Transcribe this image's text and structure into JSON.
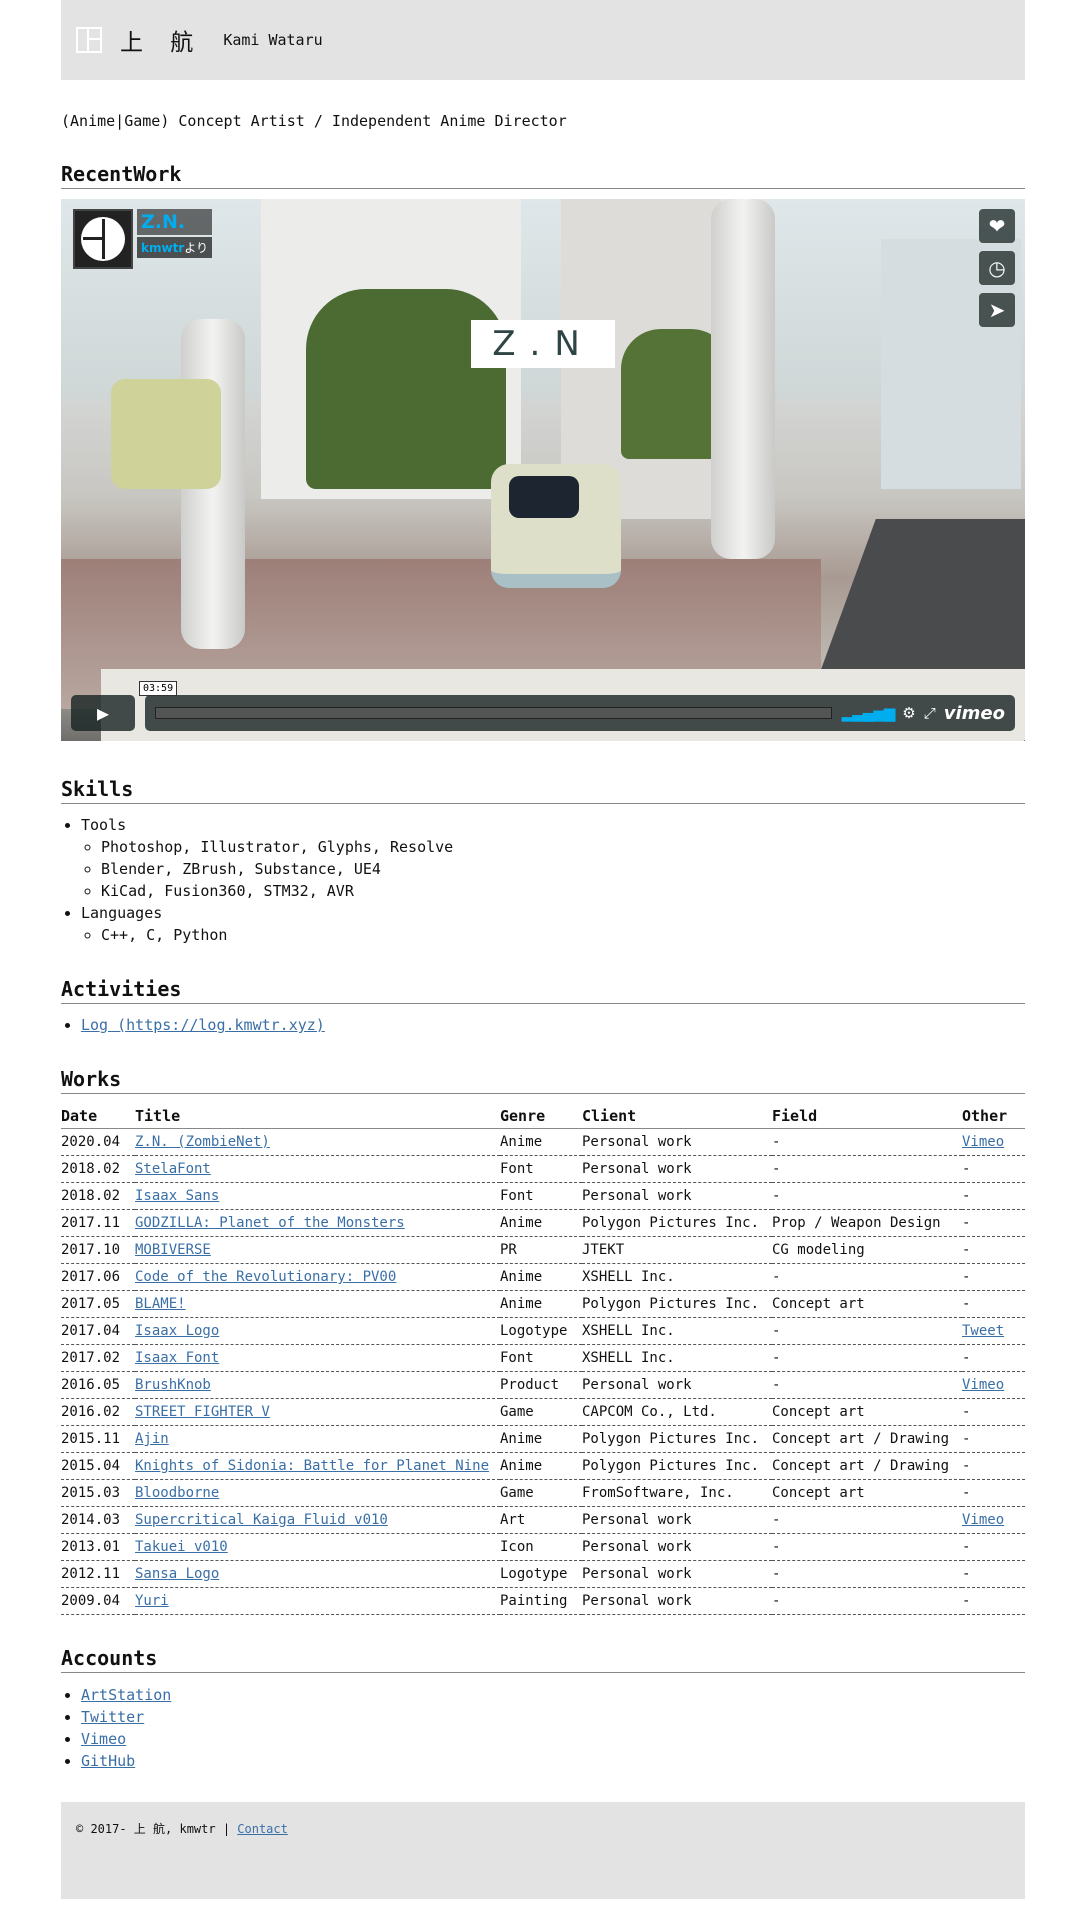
{
  "header": {
    "site_name": "上 航",
    "site_roman": "Kami Wataru"
  },
  "tagline": "(Anime|Game) Concept Artist / Independent Anime Director",
  "recent_work": {
    "heading": "RecentWork",
    "video": {
      "title": "Z.N.",
      "by_user": "kmwtr",
      "by_suffix": "より",
      "sign_text": "Z.N",
      "duration": "03:59",
      "brand": "vimeo"
    }
  },
  "skills": {
    "heading": "Skills",
    "groups": [
      {
        "label": "Tools",
        "items": [
          "Photoshop, Illustrator, Glyphs, Resolve",
          "Blender, ZBrush, Substance, UE4",
          "KiCad, Fusion360, STM32, AVR"
        ]
      },
      {
        "label": "Languages",
        "items": [
          "C++, C, Python"
        ]
      }
    ]
  },
  "activities": {
    "heading": "Activities",
    "items": [
      "Log (https://log.kmwtr.xyz)"
    ]
  },
  "works": {
    "heading": "Works",
    "columns": [
      "Date",
      "Title",
      "Genre",
      "Client",
      "Field",
      "Other"
    ],
    "rows": [
      [
        "2020.04",
        "Z.N. (ZombieNet)",
        "Anime",
        "Personal work",
        "-",
        "Vimeo"
      ],
      [
        "2018.02",
        "StelaFont",
        "Font",
        "Personal work",
        "-",
        "-"
      ],
      [
        "2018.02",
        "Isaax Sans",
        "Font",
        "Personal work",
        "-",
        "-"
      ],
      [
        "2017.11",
        "GODZILLA: Planet of the Monsters",
        "Anime",
        "Polygon Pictures Inc.",
        "Prop / Weapon Design",
        "-"
      ],
      [
        "2017.10",
        "MOBIVERSE",
        "PR",
        "JTEKT",
        "CG modeling",
        "-"
      ],
      [
        "2017.06",
        "Code of the Revolutionary: PV00",
        "Anime",
        "XSHELL Inc.",
        "-",
        "-"
      ],
      [
        "2017.05",
        "BLAME!",
        "Anime",
        "Polygon Pictures Inc.",
        "Concept art",
        "-"
      ],
      [
        "2017.04",
        "Isaax Logo",
        "Logotype",
        "XSHELL Inc.",
        "-",
        "Tweet"
      ],
      [
        "2017.02",
        "Isaax Font",
        "Font",
        "XSHELL Inc.",
        "-",
        "-"
      ],
      [
        "2016.05",
        "BrushKnob",
        "Product",
        "Personal work",
        "-",
        "Vimeo"
      ],
      [
        "2016.02",
        "STREET FIGHTER V",
        "Game",
        "CAPCOM Co., Ltd.",
        "Concept art",
        "-"
      ],
      [
        "2015.11",
        "Ajin",
        "Anime",
        "Polygon Pictures Inc.",
        "Concept art / Drawing",
        "-"
      ],
      [
        "2015.04",
        "Knights of Sidonia: Battle for Planet Nine",
        "Anime",
        "Polygon Pictures Inc.",
        "Concept art / Drawing",
        "-"
      ],
      [
        "2015.03",
        "Bloodborne",
        "Game",
        "FromSoftware, Inc.",
        "Concept art",
        "-"
      ],
      [
        "2014.03",
        "Supercritical Kaiga Fluid v010",
        "Art",
        "Personal work",
        "-",
        "Vimeo"
      ],
      [
        "2013.01",
        "Takuei v010",
        "Icon",
        "Personal work",
        "-",
        "-"
      ],
      [
        "2012.11",
        "Sansa Logo",
        "Logotype",
        "Personal work",
        "-",
        "-"
      ],
      [
        "2009.04",
        "Yuri",
        "Painting",
        "Personal work",
        "-",
        "-"
      ]
    ]
  },
  "accounts": {
    "heading": "Accounts",
    "items": [
      "ArtStation",
      "Twitter",
      "Vimeo",
      "GitHub"
    ]
  },
  "footer": {
    "copyright": "© 2017- 上 航, kmwtr | ",
    "contact": "Contact"
  },
  "colors": {
    "header_bg": "#e3e3e3",
    "link": "#3a6fa6",
    "vimeo_accent": "#00adef"
  }
}
